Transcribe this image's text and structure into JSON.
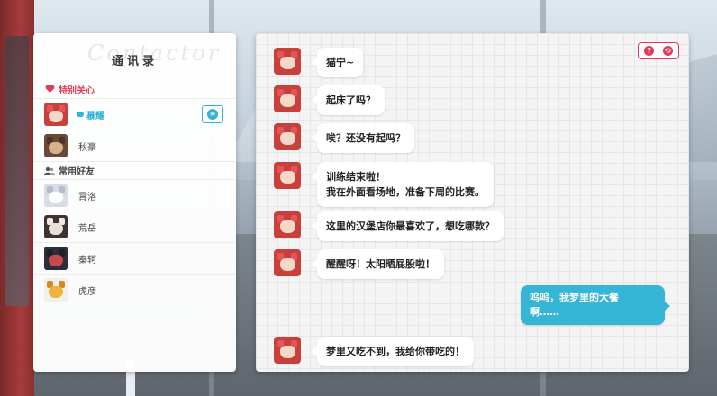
{
  "contacts": {
    "watermark": "Contactor",
    "title": "通讯录",
    "special_section": "特别关心",
    "friends_section": "常用好友",
    "special": [
      {
        "name": "慕耀",
        "active": true,
        "avatar": "av-red"
      },
      {
        "name": "秋豪",
        "active": false,
        "avatar": "av-brown"
      }
    ],
    "friends": [
      {
        "name": "霄洛",
        "avatar": "av-white"
      },
      {
        "name": "荒岳",
        "avatar": "av-bull"
      },
      {
        "name": "秦轲",
        "avatar": "av-dark"
      },
      {
        "name": "虎彦",
        "avatar": "av-tiger"
      }
    ]
  },
  "chat": {
    "controls": {
      "help_icon": "?",
      "back_icon": "⟲"
    },
    "messages": [
      {
        "text": "猫宁~"
      },
      {
        "text": "起床了吗？"
      },
      {
        "text": "唉？还没有起吗？"
      },
      {
        "line1": "训练结束啦！",
        "line2": "我在外面看场地，准备下周的比赛。"
      },
      {
        "text": "这里的汉堡店你最喜欢了，想吃哪款？"
      },
      {
        "text": "醒醒呀！太阳晒屁股啦！"
      },
      {
        "text": "梦里又吃不到，我给你带吃的！"
      }
    ],
    "outgoing": {
      "line1": "呜呜，我梦里的大餐",
      "line2": "啊……"
    }
  },
  "colors": {
    "accent_pink": "#e23b5a",
    "accent_cyan": "#36b6d6"
  }
}
